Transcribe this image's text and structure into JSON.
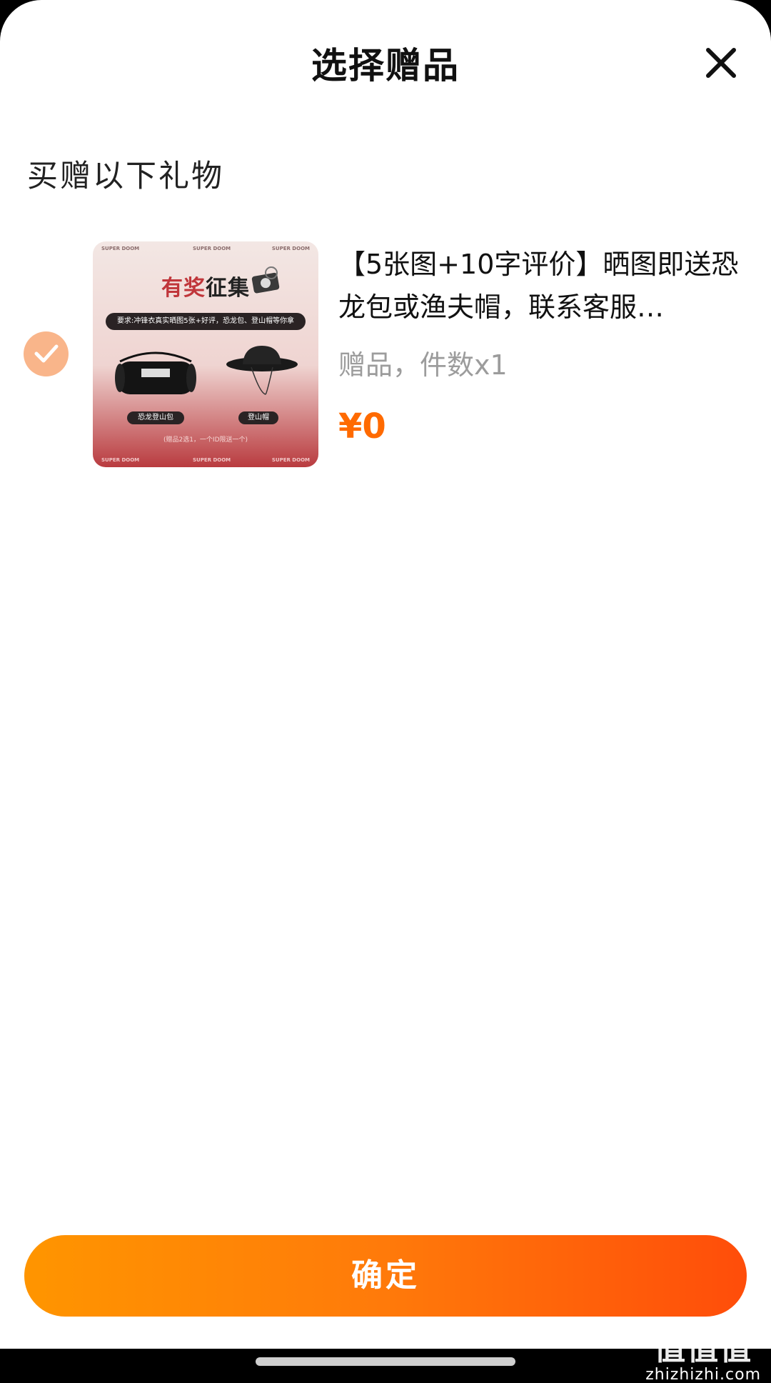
{
  "header": {
    "title": "选择赠品"
  },
  "section": {
    "label": "买赠以下礼物"
  },
  "gift": {
    "selected": true,
    "title": "【5张图+10字评价】晒图即送恐龙包或渔夫帽，联系客服…",
    "subtitle": "赠品，件数x1",
    "price": "¥0",
    "image": {
      "headline_red": "有奖",
      "headline_dark": "征集",
      "requirement": "要求:冲锋衣真实晒图5张+好评，恐龙包、登山帽等你拿",
      "item_left": "恐龙登山包",
      "item_right": "登山帽",
      "note": "(赠品2选1，一个ID限送一个)",
      "brand": "SUPER DOOM"
    }
  },
  "footer": {
    "confirm_label": "确定"
  },
  "watermark": {
    "logo": "值值值",
    "site": "zhizhizhi.com"
  },
  "colors": {
    "accent": "#ff6a00",
    "check": "#f9b58a"
  }
}
